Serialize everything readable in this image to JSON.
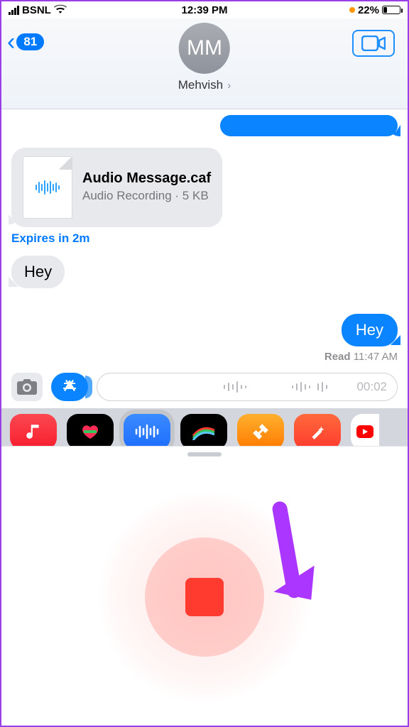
{
  "status": {
    "carrier": "BSNL",
    "time": "12:39 PM",
    "battery_pct": "22%"
  },
  "colors": {
    "accent": "#007aff",
    "record": "#ff3b30",
    "annotation": "#aa36ff"
  },
  "header": {
    "back_count": "81",
    "avatar_initials": "MM",
    "contact_name": "Mehvish"
  },
  "chat": {
    "audio_card": {
      "title": "Audio Message.caf",
      "subtitle": "Audio Recording · 5 KB"
    },
    "expires_label": "Expires in 2m",
    "incoming_text": "Hey",
    "outgoing_text": "Hey",
    "read_label": "Read",
    "read_time": "11:47 AM"
  },
  "compose": {
    "duration": "00:02"
  },
  "app_strip": {
    "apps": [
      {
        "name": "music",
        "selected": false
      },
      {
        "name": "fitness",
        "selected": false
      },
      {
        "name": "audio",
        "selected": true
      },
      {
        "name": "paint",
        "selected": false
      },
      {
        "name": "garageband",
        "selected": false
      },
      {
        "name": "memoji",
        "selected": false
      },
      {
        "name": "youtube",
        "selected": false
      }
    ]
  }
}
